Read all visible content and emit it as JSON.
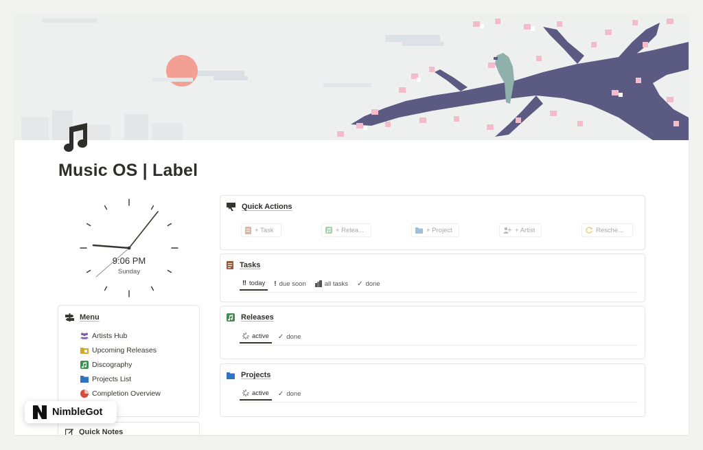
{
  "page": {
    "title": "Music OS | Label",
    "icon": "music-note-icon"
  },
  "clock": {
    "time": "9:06 PM",
    "day": "Sunday"
  },
  "menu": {
    "label": "Menu",
    "items": [
      {
        "label": "Artists Hub",
        "icon": "people-icon",
        "color": "#7b5ea7"
      },
      {
        "label": "Upcoming Releases",
        "icon": "folder-calendar-icon",
        "color": "#d4a72c"
      },
      {
        "label": "Discography",
        "icon": "music-list-icon",
        "color": "#3f8f4f"
      },
      {
        "label": "Projects List",
        "icon": "folder-icon",
        "color": "#2f74c0"
      },
      {
        "label": "Completion Overview",
        "icon": "pie-chart-icon",
        "color": "#d44c3e"
      }
    ]
  },
  "quick_notes": {
    "label": "Quick Notes"
  },
  "quick_actions": {
    "label": "Quick Actions",
    "buttons": [
      {
        "label": "+ Task",
        "icon": "task-icon"
      },
      {
        "label": "+ Relea...",
        "icon": "release-icon"
      },
      {
        "label": "+ Project",
        "icon": "folder-icon"
      },
      {
        "label": "+ Artist",
        "icon": "add-person-icon"
      },
      {
        "label": "Resche...",
        "icon": "reschedule-icon"
      }
    ]
  },
  "tasks": {
    "label": "Tasks",
    "tabs": [
      {
        "label": "today",
        "icon": "double-exclamation-icon",
        "active": true
      },
      {
        "label": "due soon",
        "icon": "exclamation-icon",
        "active": false
      },
      {
        "label": "all tasks",
        "icon": "stack-icon",
        "active": false
      },
      {
        "label": "done",
        "icon": "check-icon",
        "active": false
      }
    ]
  },
  "releases": {
    "label": "Releases",
    "tabs": [
      {
        "label": "active",
        "icon": "loading-icon",
        "active": true
      },
      {
        "label": "done",
        "icon": "check-icon",
        "active": false
      }
    ]
  },
  "projects": {
    "label": "Projects",
    "tabs": [
      {
        "label": "active",
        "icon": "loading-icon",
        "active": true
      },
      {
        "label": "done",
        "icon": "check-icon",
        "active": false
      }
    ]
  },
  "watermark": {
    "text": "NimbleGot"
  },
  "colors": {
    "cover_bg": "#eef0ef",
    "sun": "#f2a093",
    "branch": "#5a5a82",
    "blossom": "#f3bccb",
    "bird": "#8fb0ab"
  }
}
